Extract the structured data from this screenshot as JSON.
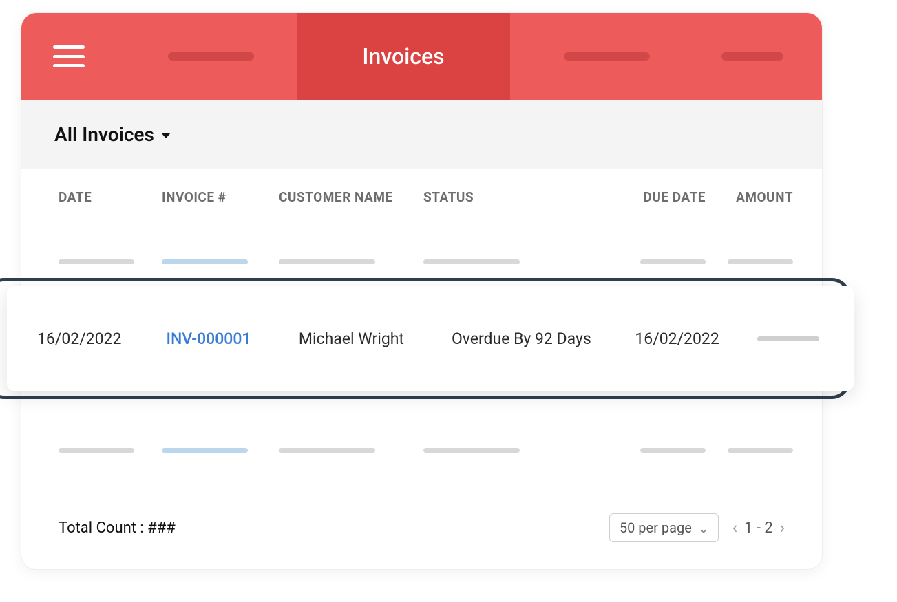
{
  "header": {
    "active_tab_label": "Invoices"
  },
  "filter": {
    "label": "All Invoices"
  },
  "table": {
    "columns": {
      "date": "DATE",
      "invoice": "INVOICE #",
      "customer": "CUSTOMER NAME",
      "status": "STATUS",
      "due_date": "DUE DATE",
      "amount": "AMOUNT"
    },
    "highlighted_row": {
      "date": "16/02/2022",
      "invoice_number": "INV-000001",
      "customer_name": "Michael Wright",
      "status": "Overdue By 92 Days",
      "due_date": "16/02/2022"
    }
  },
  "footer": {
    "total_count_label": "Total Count : ###",
    "per_page_label": "50 per page",
    "page_range": "1 - 2"
  }
}
